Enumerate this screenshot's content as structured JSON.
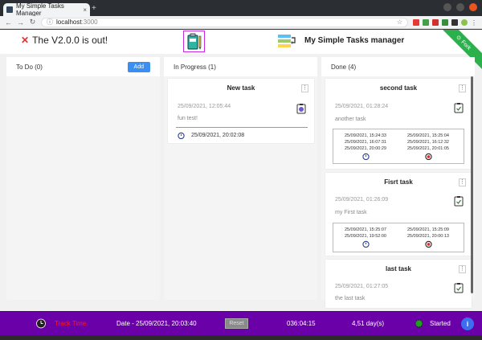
{
  "browser": {
    "tab_title": "My Simple Tasks Manager",
    "tab_close": "×",
    "new_tab": "+",
    "url_host": "localhost",
    "url_port": ":3000"
  },
  "header": {
    "announcement": "The V2.0.0 is out!",
    "title": "My Simple Tasks manager",
    "ribbon_label": "Fork"
  },
  "columns": {
    "todo": {
      "label": "To Do (0)",
      "add_label": "Add"
    },
    "in_progress": {
      "label": "In Progress (1)",
      "cards": [
        {
          "title": "New task",
          "date": "25/09/2021, 12:05:44",
          "description": "fun test!",
          "timer": "25/09/2021, 20:02:08"
        }
      ]
    },
    "done": {
      "label": "Done (4)",
      "cards": [
        {
          "title": "second task",
          "date": "25/09/2021, 01:28:24",
          "description": "another task",
          "starts": [
            "25/09/2021, 15:24:33",
            "25/09/2021, 16:07:31",
            "25/09/2021, 20:00:29"
          ],
          "ends": [
            "25/09/2021, 15:25:04",
            "25/09/2021, 16:12:32",
            "25/09/2021, 20:01:05"
          ]
        },
        {
          "title": "Fisrt task",
          "date": "25/09/2021, 01:26:09",
          "description": "my First task",
          "starts": [
            "25/09/2021, 15:25:07",
            "25/09/2021, 19:52:00"
          ],
          "ends": [
            "25/09/2021, 15:25:09",
            "25/09/2021, 20:00:13"
          ]
        },
        {
          "title": "last task",
          "date": "25/09/2021, 01:27:05",
          "description": "the last task"
        }
      ]
    }
  },
  "footer": {
    "track_label": "Track Time",
    "date_label": "Date - 25/09/2021, 20:03:40",
    "reset_label": "Reset",
    "elapsed": "036:04:15",
    "days": "4,51 day(s)",
    "status": "Started",
    "info_label": "i"
  },
  "colors": {
    "footer_bg": "#6a00a8",
    "track_time": "#ff1a1a",
    "add_button": "#3b8ff0",
    "started_dot": "#1fa01f"
  }
}
